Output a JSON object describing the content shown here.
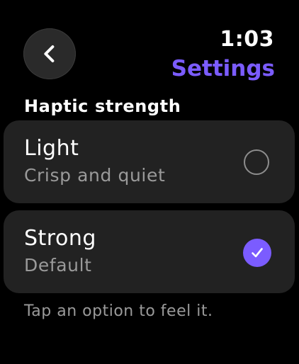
{
  "status": {
    "time": "1:03"
  },
  "header": {
    "title": "Settings",
    "back_icon": "chevron-left-icon"
  },
  "section": {
    "title": "Haptic strength"
  },
  "options": [
    {
      "title": "Light",
      "subtitle": "Crisp and quiet",
      "selected": false
    },
    {
      "title": "Strong",
      "subtitle": "Default",
      "selected": true
    }
  ],
  "footer": {
    "hint": "Tap an option to feel it."
  },
  "colors": {
    "accent": "#7b5cff",
    "background": "#000000",
    "card": "#222222",
    "secondary_text": "#9a9a9a"
  }
}
